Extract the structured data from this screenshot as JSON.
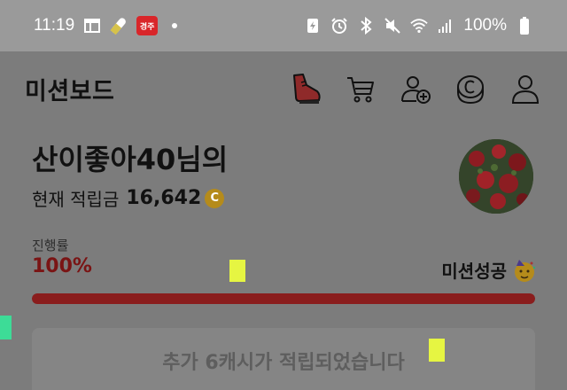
{
  "status_bar": {
    "time": "11:19",
    "app_badge_text": "경주",
    "battery": "100%"
  },
  "header": {
    "title": "미션보드",
    "icons": [
      "shoe-icon",
      "cart-icon",
      "add-user-icon",
      "coin-history-icon",
      "profile-icon"
    ]
  },
  "profile": {
    "greeting": "산이좋아40님의",
    "balance_label": "현재 적립금",
    "balance_value": "16,642",
    "coin_symbol": "C"
  },
  "progress": {
    "label": "진행률",
    "value_text": "100%",
    "fraction": 1.0,
    "status": "미션성공"
  },
  "reward": {
    "message": "추가 6캐시가 적립되었습니다"
  },
  "colors": {
    "overlay": "#7c7c7c",
    "accent_red": "#8a1d1d",
    "marker_yellow": "#e6f542",
    "marker_green": "#3ddc97"
  }
}
